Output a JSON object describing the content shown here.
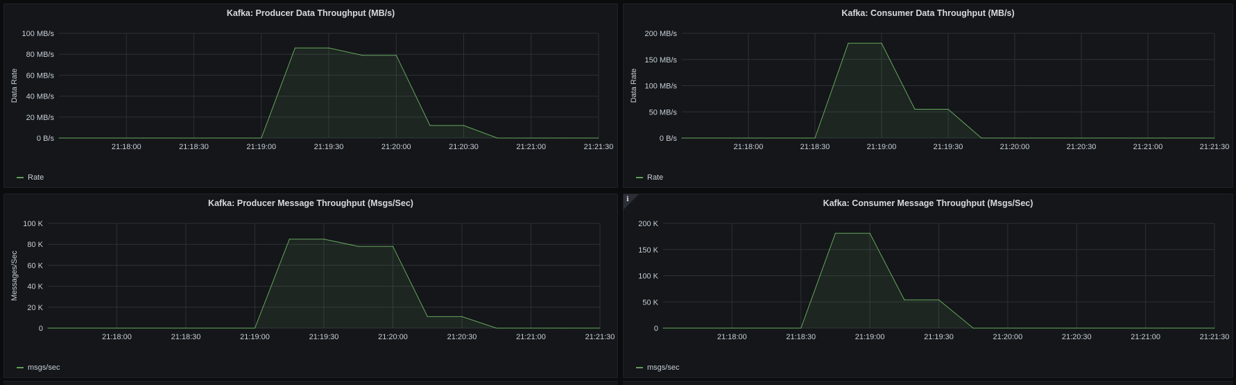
{
  "panels": [
    {
      "id": "producer-data",
      "title": "Kafka: Producer Data Throughput (MB/s)",
      "legend": "Rate",
      "info": false
    },
    {
      "id": "consumer-data",
      "title": "Kafka: Consumer Data Throughput (MB/s)",
      "legend": "Rate",
      "info": false
    },
    {
      "id": "producer-msgs",
      "title": "Kafka: Producer Message Throughput (Msgs/Sec)",
      "legend": "msgs/sec",
      "info": false
    },
    {
      "id": "consumer-msgs",
      "title": "Kafka: Consumer Message Throughput (Msgs/Sec)",
      "legend": "msgs/sec",
      "info": true,
      "info_icon": "ℹ"
    }
  ],
  "colors": {
    "series": "#73bf69",
    "grid": "#2c3036",
    "text": "#c7d0d9",
    "panel_bg": "#141619"
  },
  "chart_data": [
    {
      "type": "area",
      "title": "Kafka: Producer Data Throughput (MB/s)",
      "xlabel": "",
      "ylabel": "Data Rate",
      "x": [
        "21:17:30",
        "21:18:00",
        "21:18:30",
        "21:19:00",
        "21:19:15",
        "21:19:30",
        "21:19:45",
        "21:20:00",
        "21:20:15",
        "21:20:30",
        "21:20:45",
        "21:21:00",
        "21:21:15",
        "21:21:30"
      ],
      "x_ticks": [
        "21:18:00",
        "21:18:30",
        "21:19:00",
        "21:19:30",
        "21:20:00",
        "21:20:30",
        "21:21:00",
        "21:21:30"
      ],
      "series": [
        {
          "name": "Rate",
          "values": [
            0,
            0,
            0,
            0,
            86,
            86,
            79,
            79,
            12,
            12,
            0,
            0,
            0,
            0
          ]
        }
      ],
      "ylim": [
        0,
        100
      ],
      "y_ticks": [
        0,
        20,
        40,
        60,
        80,
        100
      ],
      "y_tick_labels": [
        "0 B/s",
        "20 MB/s",
        "40 MB/s",
        "60 MB/s",
        "80 MB/s",
        "100 MB/s"
      ],
      "grid": true,
      "legend_position": "bottom-left"
    },
    {
      "type": "area",
      "title": "Kafka: Consumer Data Throughput (MB/s)",
      "xlabel": "",
      "ylabel": "Data Rate",
      "x": [
        "21:17:30",
        "21:18:00",
        "21:18:30",
        "21:18:45",
        "21:19:00",
        "21:19:15",
        "21:19:30",
        "21:19:45",
        "21:20:00",
        "21:20:30",
        "21:21:00",
        "21:21:30"
      ],
      "x_ticks": [
        "21:18:00",
        "21:18:30",
        "21:19:00",
        "21:19:30",
        "21:20:00",
        "21:20:30",
        "21:21:00",
        "21:21:30"
      ],
      "series": [
        {
          "name": "Rate",
          "values": [
            0,
            0,
            0,
            181,
            181,
            55,
            55,
            0,
            0,
            0,
            0,
            0
          ]
        }
      ],
      "ylim": [
        0,
        200
      ],
      "y_ticks": [
        0,
        50,
        100,
        150,
        200
      ],
      "y_tick_labels": [
        "0 B/s",
        "50 MB/s",
        "100 MB/s",
        "150 MB/s",
        "200 MB/s"
      ],
      "grid": true,
      "legend_position": "bottom-left"
    },
    {
      "type": "area",
      "title": "Kafka: Producer Message Throughput (Msgs/Sec)",
      "xlabel": "",
      "ylabel": "Messages/Sec",
      "x": [
        "21:17:30",
        "21:18:00",
        "21:18:30",
        "21:19:00",
        "21:19:15",
        "21:19:30",
        "21:19:45",
        "21:20:00",
        "21:20:15",
        "21:20:30",
        "21:20:45",
        "21:21:00",
        "21:21:15",
        "21:21:30"
      ],
      "x_ticks": [
        "21:18:00",
        "21:18:30",
        "21:19:00",
        "21:19:30",
        "21:20:00",
        "21:20:30",
        "21:21:00",
        "21:21:30"
      ],
      "series": [
        {
          "name": "msgs/sec",
          "values": [
            0,
            0,
            0,
            0,
            85000,
            85000,
            78000,
            78000,
            11000,
            11000,
            0,
            0,
            0,
            0
          ]
        }
      ],
      "ylim": [
        0,
        100000
      ],
      "y_ticks": [
        0,
        20000,
        40000,
        60000,
        80000,
        100000
      ],
      "y_tick_labels": [
        "0",
        "20 K",
        "40 K",
        "60 K",
        "80 K",
        "100 K"
      ],
      "grid": true,
      "legend_position": "bottom-left"
    },
    {
      "type": "area",
      "title": "Kafka: Consumer Message Throughput (Msgs/Sec)",
      "xlabel": "",
      "ylabel": "",
      "x": [
        "21:17:30",
        "21:18:00",
        "21:18:30",
        "21:18:45",
        "21:19:00",
        "21:19:15",
        "21:19:30",
        "21:19:45",
        "21:20:00",
        "21:20:30",
        "21:21:00",
        "21:21:30"
      ],
      "x_ticks": [
        "21:18:00",
        "21:18:30",
        "21:19:00",
        "21:19:30",
        "21:20:00",
        "21:20:30",
        "21:21:00",
        "21:21:30"
      ],
      "series": [
        {
          "name": "msgs/sec",
          "values": [
            0,
            0,
            0,
            181000,
            181000,
            54000,
            54000,
            0,
            0,
            0,
            0,
            0
          ]
        }
      ],
      "ylim": [
        0,
        200000
      ],
      "y_ticks": [
        0,
        50000,
        100000,
        150000,
        200000
      ],
      "y_tick_labels": [
        "0",
        "50 K",
        "100 K",
        "150 K",
        "200 K"
      ],
      "grid": true,
      "legend_position": "bottom-left"
    }
  ]
}
